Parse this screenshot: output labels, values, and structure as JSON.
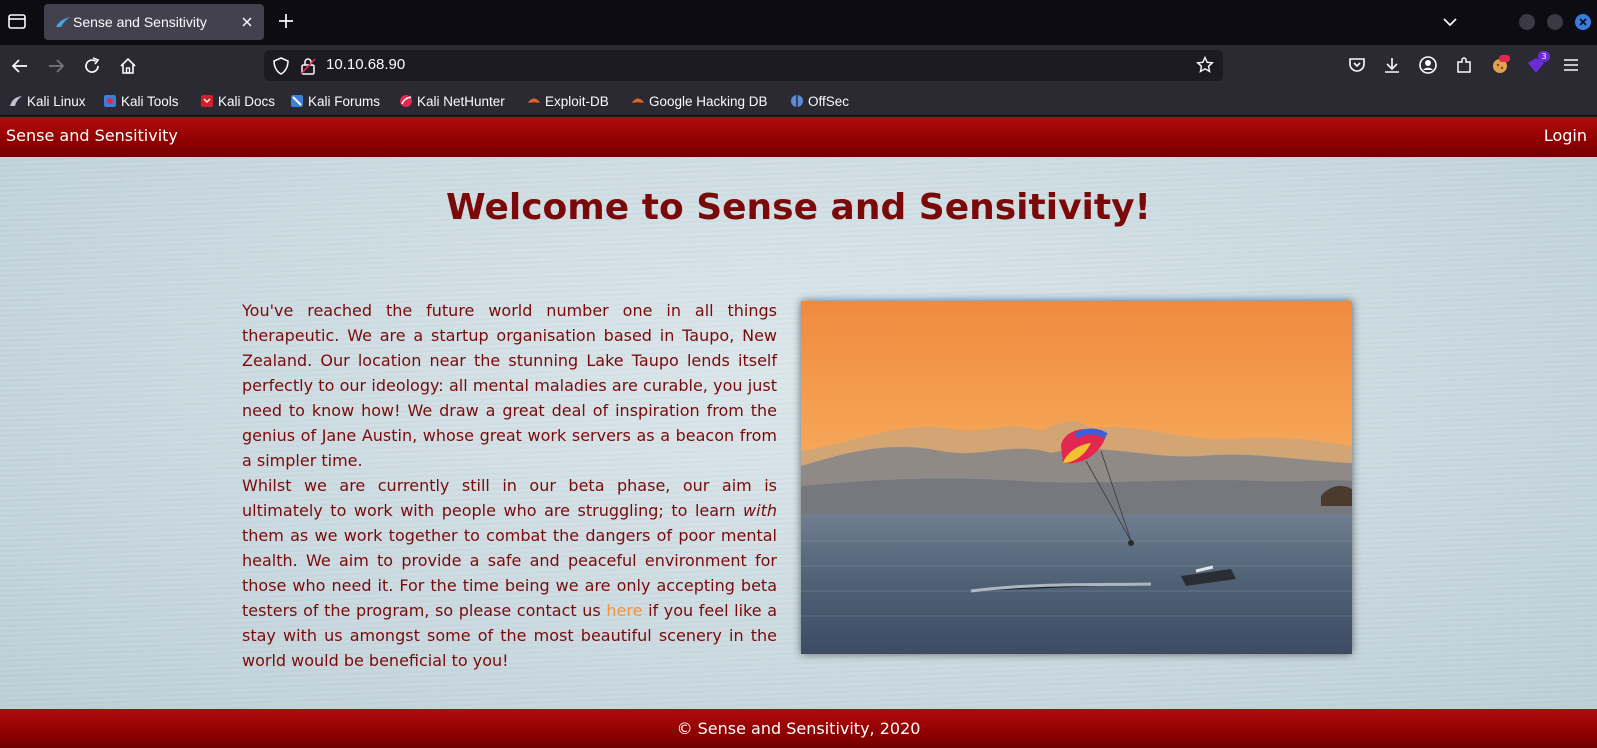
{
  "browser": {
    "tab_title": "Sense and Sensitivity",
    "url": "10.10.68.90",
    "extension_badge": "3",
    "bookmarks": [
      "Kali Linux",
      "Kali Tools",
      "Kali Docs",
      "Kali Forums",
      "Kali NetHunter",
      "Exploit-DB",
      "Google Hacking DB",
      "OffSec"
    ]
  },
  "site": {
    "brand": "Sense and Sensitivity",
    "login_label": "Login",
    "heading": "Welcome to Sense and Sensitivity!",
    "intro_paragraph": "You've reached the future world number one in all things therapeutic. We are a startup organisation based in Taupo, New Zealand. Our location near the stunning Lake Taupo lends itself perfectly to our ideology: all mental maladies are curable, you just need to know how! We draw a great deal of inspiration from the genius of Jane Austin, whose great work servers as a beacon from a simpler time.",
    "aim_part1": "Whilst we are currently still in our beta phase, our aim is ultimately to work with people who are struggling; to learn ",
    "aim_emphasis": "with",
    "aim_part2": " them as we work together to combat the dangers of poor mental health. We aim to provide a safe and peaceful environment for those who need it. For the time being we are only accepting beta testers of the program, so please contact us ",
    "aim_link": "here",
    "aim_part3": " if you feel like a stay with us amongst some of the most beautiful scenery in the world would be beneficial to you!",
    "footer": "© Sense and Sensitivity, 2020"
  },
  "colors": {
    "header_red": "#8a0000",
    "text_red": "#7a0a0a",
    "link_orange": "#f2923c"
  }
}
